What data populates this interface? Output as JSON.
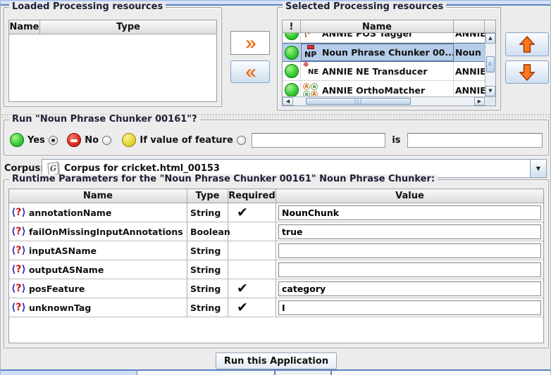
{
  "panels": {
    "loaded": {
      "title": "Loaded Processing resources",
      "columns": [
        "Name",
        "Type"
      ]
    },
    "selected": {
      "title": "Selected Processing resources",
      "columns": [
        "!",
        "Name",
        ""
      ],
      "rows": [
        {
          "icon": "pos-tagger-icon",
          "name": "ANNIE POS Tagger",
          "type": "ANNIE",
          "selected": false
        },
        {
          "icon": "np-chunker-icon",
          "name": "Noun Phrase Chunker 00...",
          "type": "Noun",
          "selected": true
        },
        {
          "icon": "ne-transducer-icon",
          "name": "ANNIE NE Transducer",
          "type": "ANNIE",
          "selected": false
        },
        {
          "icon": "orthomatcher-icon",
          "name": "ANNIE OrthoMatcher",
          "type": "ANNIE",
          "selected": false
        }
      ]
    }
  },
  "transfer": {
    "add": "»",
    "remove": "«"
  },
  "run": {
    "title": "Run \"Noun Phrase Chunker 00161\"?",
    "options": [
      {
        "label": "Yes",
        "led": "green",
        "selected": true
      },
      {
        "label": "No",
        "led": "red",
        "selected": false
      },
      {
        "label": "If value of feature",
        "led": "yellow",
        "selected": false
      }
    ],
    "feature_field": "",
    "is_label": "is",
    "value_field": ""
  },
  "corpus": {
    "label": "Corpus:",
    "value": "Corpus for cricket.html_00153"
  },
  "params": {
    "title": "Runtime Parameters for the \"Noun Phrase Chunker 00161\" Noun Phrase Chunker:",
    "columns": [
      "Name",
      "Type",
      "Required",
      "Value"
    ],
    "rows": [
      {
        "name": "annotationName",
        "type": "String",
        "required_mark": "✔",
        "value": "NounChunk"
      },
      {
        "name": "failOnMissingInputAnnotations",
        "type": "Boolean",
        "required_mark": "",
        "value": "true"
      },
      {
        "name": "inputASName",
        "type": "String",
        "required_mark": "",
        "value": ""
      },
      {
        "name": "outputASName",
        "type": "String",
        "required_mark": "",
        "value": ""
      },
      {
        "name": "posFeature",
        "type": "String",
        "required_mark": "✔",
        "value": "category"
      },
      {
        "name": "unknownTag",
        "type": "String",
        "required_mark": "✔",
        "value": "I"
      }
    ]
  },
  "footer": {
    "run_button": "Run this Application"
  },
  "icons": {
    "corpus_glyph": "G",
    "combo_arrow": "▼",
    "scroll_up": "▲",
    "scroll_down": "▼",
    "scroll_left": "◀",
    "scroll_right": "▶",
    "v_grip": "≡",
    "h_grip": "|||",
    "param_bracket_open": "⟨",
    "param_question": "?",
    "param_bracket_close": "⟩",
    "ne_flower": "❋",
    "ne_text": "NE",
    "np_text": "NP",
    "ortho_letters": [
      "A",
      "a",
      "a",
      "A"
    ]
  },
  "colors": {
    "selection": "#b6cde9",
    "accent_orange": "#ff6600",
    "led_green": "#38cc38",
    "led_red": "#dd2a20",
    "led_yellow": "#e4d432"
  }
}
